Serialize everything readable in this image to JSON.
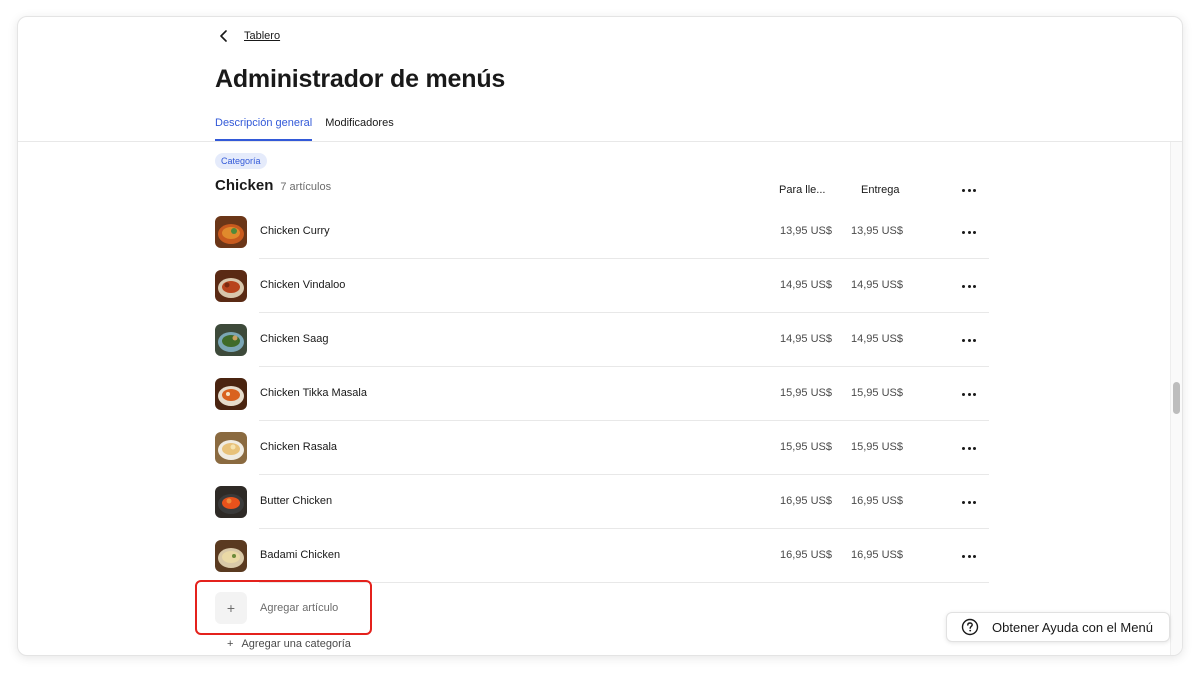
{
  "nav": {
    "back_label": "Tablero"
  },
  "page_title": "Administrador de menús",
  "tabs": [
    {
      "label": "Descripción general",
      "active": true
    },
    {
      "label": "Modificadores",
      "active": false
    }
  ],
  "category": {
    "badge": "Categoría",
    "name": "Chicken",
    "count": "7 artículos",
    "columns": {
      "pickup": "Para lle...",
      "delivery": "Entrega"
    }
  },
  "items": [
    {
      "name": "Chicken Curry",
      "pickup": "13,95 US$",
      "delivery": "13,95 US$"
    },
    {
      "name": "Chicken Vindaloo",
      "pickup": "14,95 US$",
      "delivery": "14,95 US$"
    },
    {
      "name": "Chicken Saag",
      "pickup": "14,95 US$",
      "delivery": "14,95 US$"
    },
    {
      "name": "Chicken Tikka Masala",
      "pickup": "15,95 US$",
      "delivery": "15,95 US$"
    },
    {
      "name": "Chicken Rasala",
      "pickup": "15,95 US$",
      "delivery": "15,95 US$"
    },
    {
      "name": "Butter Chicken",
      "pickup": "16,95 US$",
      "delivery": "16,95 US$"
    },
    {
      "name": "Badami Chicken",
      "pickup": "16,95 US$",
      "delivery": "16,95 US$"
    }
  ],
  "add_item_label": "Agregar artículo",
  "add_category_label": "Agregar una categoría",
  "help_label": "Obtener Ayuda con el Menú",
  "colors": {
    "accent": "#3259d8",
    "highlight": "#e4211c"
  }
}
